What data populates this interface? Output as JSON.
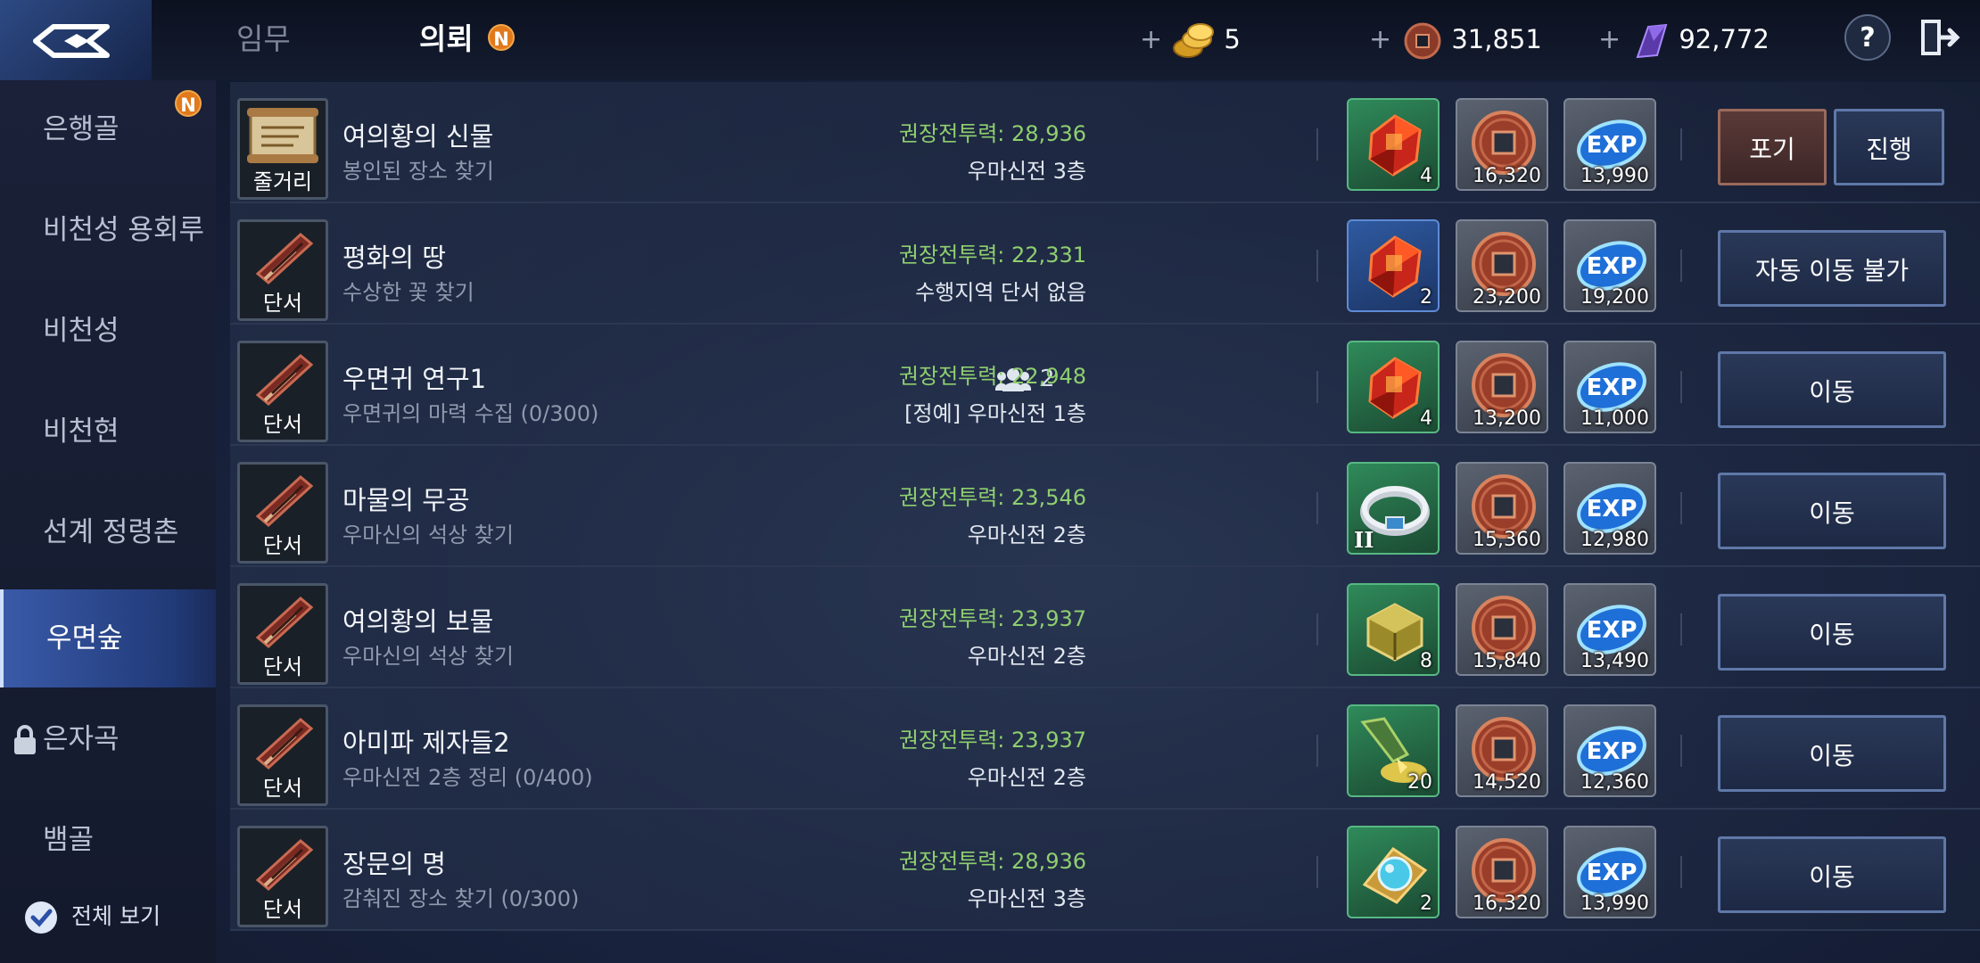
{
  "header": {
    "tabs": [
      {
        "label": "임무",
        "active": false
      },
      {
        "label": "의뢰",
        "active": true,
        "badge": "N"
      }
    ],
    "currencies": [
      {
        "icon": "gold-coins-icon",
        "value": "5"
      },
      {
        "icon": "bronze-coin-icon",
        "value": "31,851"
      },
      {
        "icon": "purple-crystal-icon",
        "value": "92,772"
      }
    ],
    "plus": "+",
    "help_label": "?"
  },
  "sidebar": {
    "items": [
      {
        "label": "은행골",
        "badge": "N"
      },
      {
        "label": "비천성 용회루"
      },
      {
        "label": "비천성"
      },
      {
        "label": "비천현"
      },
      {
        "label": "선계 정령촌"
      },
      {
        "label": "우면숲",
        "active": true
      },
      {
        "label": "은자곡",
        "locked": true
      },
      {
        "label": "뱀골"
      }
    ],
    "view_all_label": "전체 보기",
    "view_all_checked": true
  },
  "quests": [
    {
      "type": "줄거리",
      "title": "여의황의 신물",
      "subtitle": "봉인된 장소 찾기",
      "party": "",
      "power": "권장전투력: 28,936",
      "location": "우마신전 3층",
      "reward_item": {
        "icon": "red-gem-icon",
        "count": "4",
        "frame": "green"
      },
      "reward_coin": "16,320",
      "reward_exp": "13,990",
      "buttons": [
        "포기",
        "진행"
      ]
    },
    {
      "type": "단서",
      "title": "평화의 땅",
      "subtitle": "수상한 꽃 찾기",
      "party": "",
      "power": "권장전투력: 22,331",
      "location": "수행지역 단서 없음",
      "reward_item": {
        "icon": "red-gem-icon",
        "count": "2",
        "frame": "blue"
      },
      "reward_coin": "23,200",
      "reward_exp": "19,200",
      "buttons": [
        "자동 이동 불가"
      ]
    },
    {
      "type": "단서",
      "title": "우면귀 연구1",
      "subtitle": "우면귀의 마력 수집 (0/300)",
      "party": "2",
      "power": "권장전투력: 22,948",
      "location": "[정예] 우마신전 1층",
      "reward_item": {
        "icon": "red-gem-icon",
        "count": "4",
        "frame": "green"
      },
      "reward_coin": "13,200",
      "reward_exp": "11,000",
      "buttons": [
        "이동"
      ]
    },
    {
      "type": "단서",
      "title": "마물의 무공",
      "subtitle": "우마신의 석상 찾기",
      "party": "",
      "power": "권장전투력: 23,546",
      "location": "우마신전 2층",
      "reward_item": {
        "icon": "ring-icon",
        "count": "",
        "grade": "II",
        "frame": "green"
      },
      "reward_coin": "15,360",
      "reward_exp": "12,980",
      "buttons": [
        "이동"
      ]
    },
    {
      "type": "단서",
      "title": "여의황의 보물",
      "subtitle": "우마신의 석상 찾기",
      "party": "",
      "power": "권장전투력: 23,937",
      "location": "우마신전 2층",
      "reward_item": {
        "icon": "gold-cube-icon",
        "count": "8",
        "frame": "green"
      },
      "reward_coin": "15,840",
      "reward_exp": "13,490",
      "buttons": [
        "이동"
      ]
    },
    {
      "type": "단서",
      "title": "아미파 제자들2",
      "subtitle": "우마신전 2층 정리 (0/400)",
      "party": "",
      "power": "권장전투력: 23,937",
      "location": "우마신전 2층",
      "reward_item": {
        "icon": "pouring-powder-icon",
        "count": "20",
        "frame": "green"
      },
      "reward_coin": "14,520",
      "reward_exp": "12,360",
      "buttons": [
        "이동"
      ]
    },
    {
      "type": "단서",
      "title": "장문의 명",
      "subtitle": "감춰진 장소 찾기 (0/300)",
      "party": "",
      "power": "권장전투력: 28,936",
      "location": "우마신전 3층",
      "reward_item": {
        "icon": "blue-orb-icon",
        "count": "2",
        "frame": "green"
      },
      "reward_coin": "16,320",
      "reward_exp": "13,990",
      "buttons": [
        "이동"
      ]
    }
  ],
  "exp_label": "EXP",
  "colors": {
    "power": "#8fcf6f",
    "active_tab": "#3a5aa8",
    "badge": "#e07a1c"
  }
}
